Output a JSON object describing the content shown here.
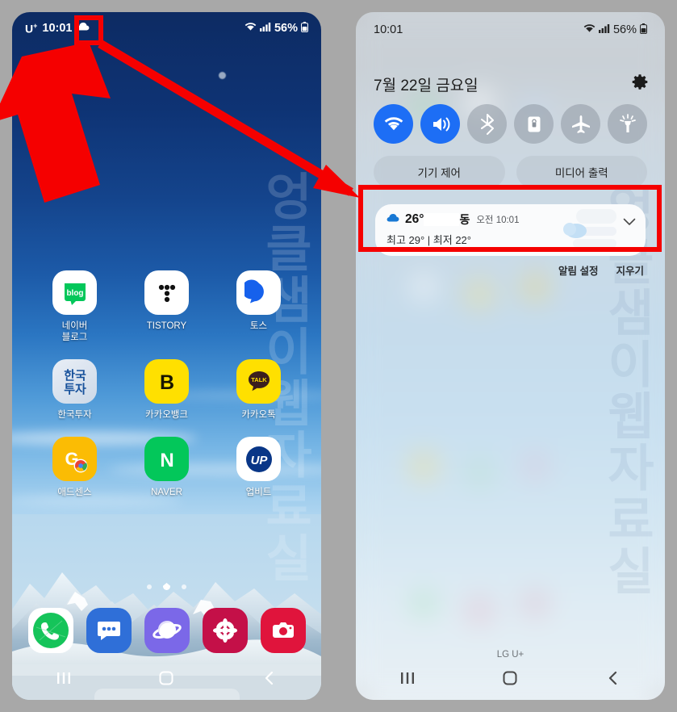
{
  "meta": {
    "watermark": "엉클샘이웹자료실"
  },
  "left_phone": {
    "name": "home-screen",
    "status_bar": {
      "carrier": "U",
      "carrier_sup": "+",
      "time": "10:01",
      "weather_icon": "cloud-icon",
      "wifi_icon": "wifi-icon",
      "signal_icon": "cellular-signal-icon",
      "battery_percent": "56%",
      "battery_icon": "battery-icon"
    },
    "app_rows": [
      [
        {
          "label": "네이버\n블로그",
          "icon": "naver-blog-icon"
        },
        {
          "label": "TISTORY",
          "icon": "tistory-icon"
        },
        {
          "label": "토스",
          "icon": "toss-icon"
        }
      ],
      [
        {
          "label": "한국투자",
          "icon": "korea-investment-icon"
        },
        {
          "label": "카카오뱅크",
          "icon": "kakaobank-icon"
        },
        {
          "label": "카카오톡",
          "icon": "kakaotalk-icon"
        }
      ],
      [
        {
          "label": "애드센스",
          "icon": "adsense-icon"
        },
        {
          "label": "NAVER",
          "icon": "naver-icon"
        },
        {
          "label": "업비트",
          "icon": "upbit-icon"
        }
      ]
    ],
    "page_dots": {
      "count": 3,
      "active_index": 1
    },
    "dock": [
      {
        "icon": "phone-icon"
      },
      {
        "icon": "messages-icon"
      },
      {
        "icon": "samsung-internet-icon"
      },
      {
        "icon": "gallery-icon"
      },
      {
        "icon": "camera-icon"
      }
    ],
    "nav_bar": {
      "recents": "recents-icon",
      "home": "home-icon",
      "back": "back-icon"
    }
  },
  "right_phone": {
    "name": "notification-panel",
    "status_bar": {
      "time": "10:01",
      "wifi_icon": "wifi-icon",
      "signal_icon": "cellular-signal-icon",
      "battery_percent": "56%",
      "battery_icon": "battery-icon"
    },
    "date": "7월 22일 금요일",
    "settings_icon": "gear-icon",
    "toggles": [
      {
        "name": "wifi",
        "icon": "wifi-icon",
        "active": true
      },
      {
        "name": "sound",
        "icon": "sound-icon",
        "active": true
      },
      {
        "name": "bluetooth",
        "icon": "bluetooth-icon",
        "active": false
      },
      {
        "name": "auto-rotate-lock",
        "icon": "rotation-lock-icon",
        "active": false
      },
      {
        "name": "airplane-mode",
        "icon": "airplane-icon",
        "active": false
      },
      {
        "name": "flashlight",
        "icon": "flashlight-icon",
        "active": false
      }
    ],
    "control_buttons": [
      {
        "label": "기기 제어"
      },
      {
        "label": "미디어 출력"
      }
    ],
    "weather_notification": {
      "icon": "cloud-icon",
      "temperature": "26°",
      "location_redacted": true,
      "location_suffix": "동",
      "time": "오전 10:01",
      "high_low": "최고 29° | 최저 22°",
      "expand_icon": "chevron-down-icon"
    },
    "notification_footer": [
      {
        "label": "알림 설정"
      },
      {
        "label": "지우기"
      }
    ],
    "carrier_label": "LG U+",
    "nav_bar": {
      "recents": "recents-icon",
      "home": "home-icon",
      "back": "back-icon"
    }
  },
  "annotations": {
    "color": "#f50000",
    "highlight_status_icon": "red-box-around-cloud-status-icon",
    "highlight_notification": "red-box-around-weather-notification",
    "arrow_up": "thick-red-arrow-pointing-to-status-icon",
    "arrow_diagonal": "red-arrow-pointing-to-weather-notification"
  }
}
